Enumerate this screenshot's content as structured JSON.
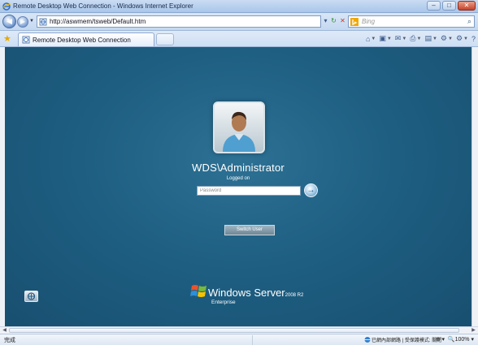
{
  "window": {
    "title": "Remote Desktop Web Connection - Windows Internet Explorer",
    "controls": [
      "–",
      "□",
      "✕"
    ]
  },
  "address_bar": {
    "url": "http://aswmem/tsweb/Default.htm",
    "search_placeholder": "Bing"
  },
  "tab": {
    "label": "Remote Desktop Web Connection"
  },
  "login": {
    "user_name": "WDS\\Administrator",
    "status": "Logged on",
    "password_placeholder": "Password",
    "go_button": "→",
    "switch_user_label": "Switch User"
  },
  "branding": {
    "product": "Windows Server",
    "version": "2008 R2",
    "edition": "Enterprise"
  },
  "status_bar": {
    "ready": "完成",
    "zone": "已網內部網路 | 受保護模式: 關閉",
    "zoom": "100%"
  },
  "colors": {
    "content_bg": "#1e5f82",
    "chrome_bg": "#c4d8f0"
  }
}
